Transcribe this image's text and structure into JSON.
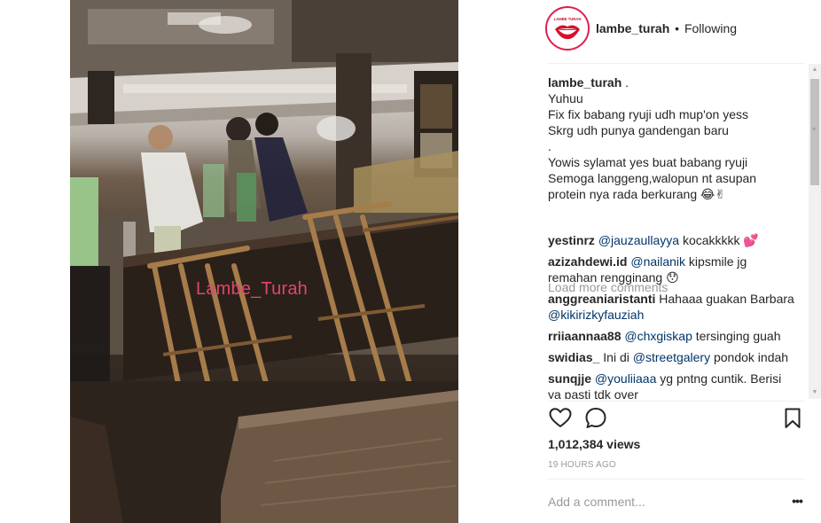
{
  "media": {
    "watermark": "Lambe_Turah"
  },
  "header": {
    "username": "lambe_turah",
    "separator": "•",
    "follow_status": "Following",
    "avatar_logo": "LAMBE TURAH"
  },
  "caption": {
    "username": "lambe_turah",
    "lines": [
      ".",
      "Yuhuu",
      "Fix fix babang ryuji udh mup'on yess",
      "Skrg udh punya gandengan baru",
      ".",
      "Yowis sylamat yes buat babang ryuji",
      "Semoga langgeng,walopun nt asupan",
      "protein nya rada berkurang 😂✌"
    ]
  },
  "load_more": "Load more comments",
  "comments": [
    {
      "user": "yestinrz",
      "mention": "@jauzaullayya",
      "text_after": " kocakkkkk 💕"
    },
    {
      "user": "azizahdewi.id",
      "mention": "@nailanik",
      "text_after": " kipsmile jg",
      "line2": "remahan rengginang 😯"
    },
    {
      "user": "anggreaniaristanti",
      "text_before": " Hahaaa guakan Barbara",
      "line2_mention": "@kikirizkyfauziah"
    },
    {
      "user": "rriiaannaa88",
      "mention": "@chxgiskap",
      "text_after": " tersinging guah"
    },
    {
      "user": "swidias_",
      "text_before": " Ini di ",
      "mention": "@streetgalery",
      "text_after": " pondok indah"
    },
    {
      "user": "sunqjje",
      "mention": "@youliiaaa",
      "text_after": " yg pntng cuntik. Berisi",
      "line2": "ya pasti tdk over"
    }
  ],
  "actions": {
    "like_icon": "heart-icon",
    "comment_icon": "comment-icon",
    "save_icon": "bookmark-icon"
  },
  "views": "1,012,384 views",
  "timestamp": "19 HOURS AGO",
  "add_comment_placeholder": "Add a comment...",
  "more_label": "•••",
  "colors": {
    "mention": "#003569",
    "muted": "#999999",
    "avatar_ring": "#e01e4f",
    "watermark": "#e0466a"
  }
}
